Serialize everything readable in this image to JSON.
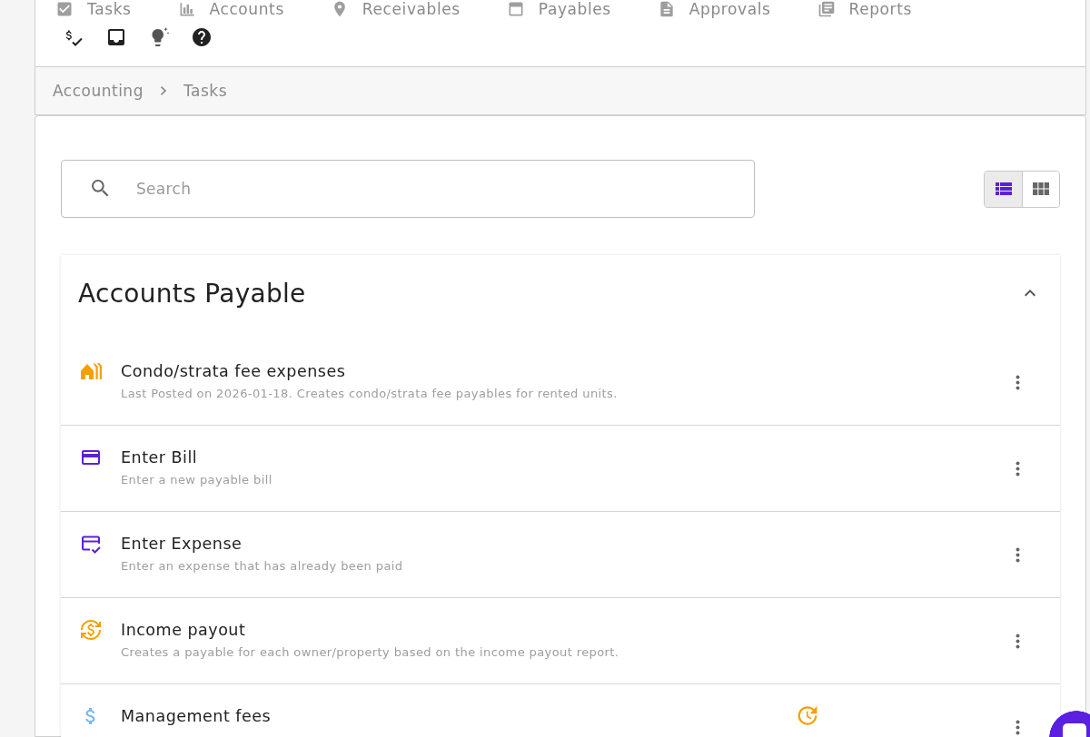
{
  "nav": {
    "tabs": [
      {
        "label": "Tasks"
      },
      {
        "label": "Accounts"
      },
      {
        "label": "Receivables"
      },
      {
        "label": "Payables"
      },
      {
        "label": "Approvals"
      },
      {
        "label": "Reports"
      }
    ]
  },
  "breadcrumb": [
    "Accounting",
    "Tasks"
  ],
  "search": {
    "placeholder": "Search"
  },
  "view_toggle": [
    {
      "kind": "list",
      "selected": true
    },
    {
      "kind": "grid",
      "selected": false
    }
  ],
  "section": {
    "title": "Accounts Payable",
    "expanded": true,
    "tasks": [
      {
        "title": "Condo/strata fee expenses",
        "description": "Last Posted on 2026-01-18. Creates condo/strata fee payables for rented units.",
        "color": "#f5a000",
        "recurring": false
      },
      {
        "title": "Enter Bill",
        "description": "Enter a new payable bill",
        "color": "#5b21d6",
        "recurring": false
      },
      {
        "title": "Enter Expense",
        "description": "Enter an expense that has already been paid",
        "color": "#5b21d6",
        "recurring": false
      },
      {
        "title": "Income payout",
        "description": "Creates a payable for each owner/property based on the income payout report.",
        "color": "#f5a000",
        "recurring": false
      },
      {
        "title": "Management fees",
        "color": "#7ab8f0",
        "recurring": true
      }
    ]
  }
}
